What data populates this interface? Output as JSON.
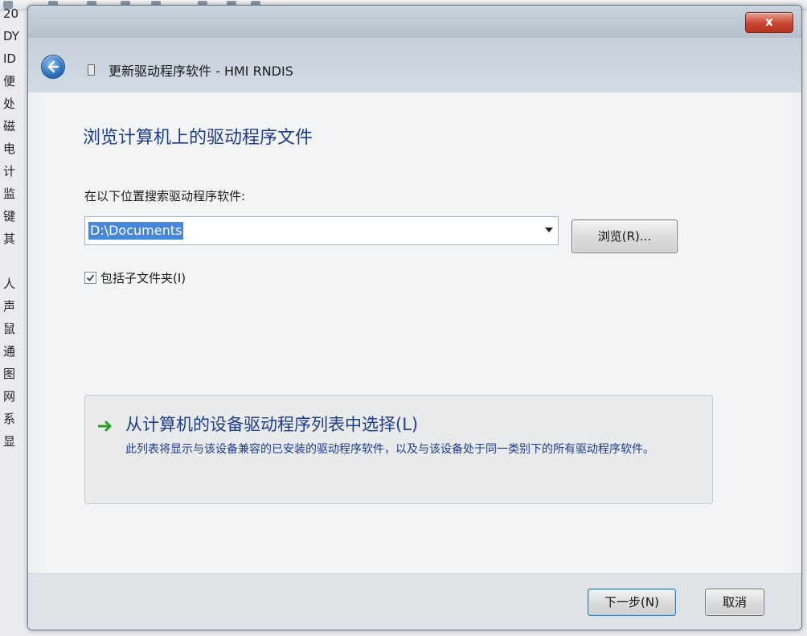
{
  "background_window": {
    "tree_items": [
      "20",
      "DY",
      "ID",
      "便",
      "处",
      "磁",
      "电",
      "计",
      "监",
      "键",
      "其",
      "",
      "人",
      "声",
      "鼠",
      "通",
      "图",
      "网",
      "系",
      "显"
    ]
  },
  "dialog": {
    "title": "更新驱动程序软件 - HMI RNDIS",
    "close_label": "x"
  },
  "content": {
    "heading": "浏览计算机上的驱动程序文件",
    "search_label": "在以下位置搜索驱动程序软件:",
    "path_value": "D:\\Documents",
    "browse_label": "浏览(R)...",
    "include_subfolders_label": "包括子文件夹(I)",
    "include_subfolders_checked": true,
    "option": {
      "title": "从计算机的设备驱动程序列表中选择(L)",
      "description": "此列表将显示与该设备兼容的已安装的驱动程序软件，以及与该设备处于同一类别下的所有驱动程序软件。"
    }
  },
  "footer": {
    "next_label": "下一步(N)",
    "cancel_label": "取消"
  },
  "colors": {
    "accent_blue": "#1e3c8c",
    "selection_blue": "#4a86d6",
    "arrow_green": "#2aa02a"
  }
}
